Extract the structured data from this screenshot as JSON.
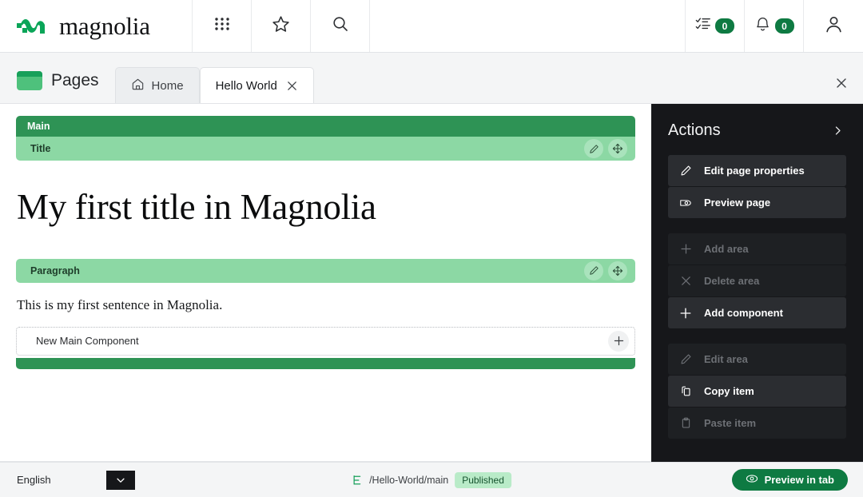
{
  "topbar": {
    "brand_name": "magnolia",
    "brand_logo_icon": "magnolia-wave-logo",
    "apps_icon": "apps-grid-icon",
    "favorites_icon": "star-icon",
    "search_icon": "search-icon",
    "tasks": {
      "icon": "tasks-checklist-icon",
      "count": "0"
    },
    "notifications": {
      "icon": "bell-icon",
      "count": "0"
    },
    "user_icon": "user-avatar-icon"
  },
  "tabbar": {
    "app_icon": "pages-app-icon",
    "app_title": "Pages",
    "close_icon": "close-icon",
    "tabs": [
      {
        "label": "Home",
        "icon": "home-icon",
        "active": false,
        "closable": false
      },
      {
        "label": "Hello World",
        "icon": "",
        "active": true,
        "closable": true,
        "close_icon": "close-icon"
      }
    ]
  },
  "stage": {
    "area": {
      "label": "Main",
      "components": [
        {
          "label": "Title",
          "edit_icon": "pencil-icon",
          "move_icon": "move-arrows-icon",
          "content": "My first title in Magnolia",
          "content_style": "heading"
        },
        {
          "label": "Paragraph",
          "edit_icon": "pencil-icon",
          "move_icon": "move-arrows-icon",
          "content": "This is my first sentence in Magnolia.",
          "content_style": "paragraph"
        }
      ],
      "new_component": {
        "label": "New Main Component",
        "add_icon": "plus-icon"
      }
    }
  },
  "actions": {
    "title": "Actions",
    "collapse_icon": "chevron-right-icon",
    "groups": [
      [
        {
          "label": "Edit page properties",
          "icon": "pencil-icon",
          "enabled": true
        },
        {
          "label": "Preview page",
          "icon": "preview-eye-icon",
          "enabled": true
        }
      ],
      [
        {
          "label": "Add area",
          "icon": "plus-icon",
          "enabled": false
        },
        {
          "label": "Delete area",
          "icon": "close-x-icon",
          "enabled": false
        },
        {
          "label": "Add component",
          "icon": "plus-icon",
          "enabled": true
        }
      ],
      [
        {
          "label": "Edit area",
          "icon": "pencil-icon",
          "enabled": false
        },
        {
          "label": "Copy item",
          "icon": "copy-icon",
          "enabled": true
        },
        {
          "label": "Paste item",
          "icon": "clipboard-icon",
          "enabled": false
        }
      ]
    ]
  },
  "statusbar": {
    "language": "English",
    "language_dropdown_icon": "chevron-down-icon",
    "tree_icon": "tree-hierarchy-icon",
    "path": "/Hello-World/main",
    "status": "Published",
    "preview_button": {
      "label": "Preview in tab",
      "icon": "eye-icon"
    }
  },
  "colors": {
    "brand_green": "#0e7a42",
    "area_green": "#2e9355",
    "component_green": "#8cd8a4",
    "panel_dark": "#16171a",
    "published_badge_bg": "#b9ebc8"
  }
}
